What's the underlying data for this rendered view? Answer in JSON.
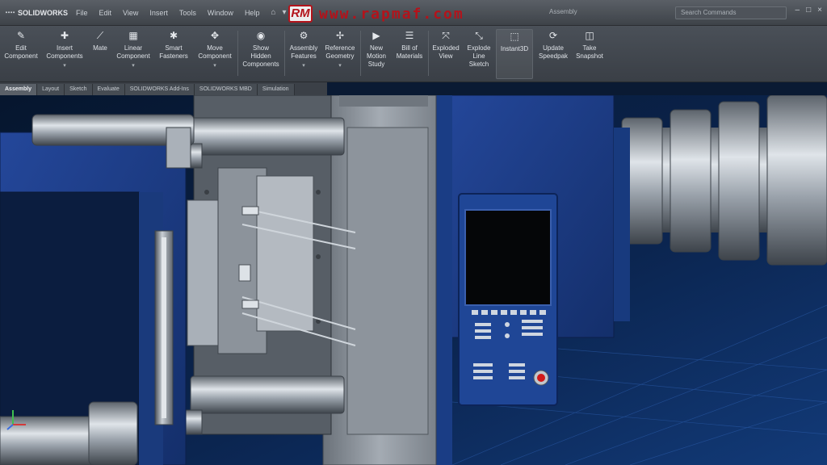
{
  "app": {
    "brand": "SOLIDWORKS",
    "menus": [
      "File",
      "Edit",
      "View",
      "Insert",
      "Tools",
      "Window",
      "Help"
    ],
    "document_title": "Assembly",
    "search_placeholder": "Search Commands"
  },
  "watermark": {
    "logo": "RM",
    "text": "www.rapmaf.com"
  },
  "ribbon": {
    "items": [
      {
        "label": "Edit\nComponent",
        "icon": "edit-component-icon"
      },
      {
        "label": "Insert\nComponents",
        "icon": "insert-components-icon"
      },
      {
        "label": "Mate",
        "icon": "mate-icon"
      },
      {
        "label": "Linear\nComponent",
        "icon": "linear-pattern-icon"
      },
      {
        "label": "Smart\nFasteners",
        "icon": "smart-fasteners-icon"
      },
      {
        "label": "Move\nComponent",
        "icon": "move-component-icon"
      },
      {
        "label": "Show\nHidden\nComponents",
        "icon": "show-hidden-icon"
      },
      {
        "label": "Assembly\nFeatures",
        "icon": "assembly-features-icon"
      },
      {
        "label": "Reference\nGeometry",
        "icon": "reference-geometry-icon"
      },
      {
        "label": "New\nMotion\nStudy",
        "icon": "motion-study-icon"
      },
      {
        "label": "Bill of\nMaterials",
        "icon": "bom-icon"
      },
      {
        "label": "Exploded\nView",
        "icon": "exploded-view-icon"
      },
      {
        "label": "Explode\nLine\nSketch",
        "icon": "explode-line-icon"
      },
      {
        "label": "Instant3D",
        "icon": "instant3d-icon"
      },
      {
        "label": "Update\nSpeedpak",
        "icon": "speedpak-icon"
      },
      {
        "label": "Take\nSnapshot",
        "icon": "snapshot-icon"
      }
    ]
  },
  "tabs": [
    "Assembly",
    "Layout",
    "Sketch",
    "Evaluate",
    "SOLIDWORKS Add-Ins",
    "SOLIDWORKS MBD",
    "Simulation"
  ],
  "colors": {
    "machine_blue": "#1d3f8a",
    "steel": "#9aa2ab",
    "watermark_red": "#b3131b",
    "background": "#0a1a33"
  }
}
